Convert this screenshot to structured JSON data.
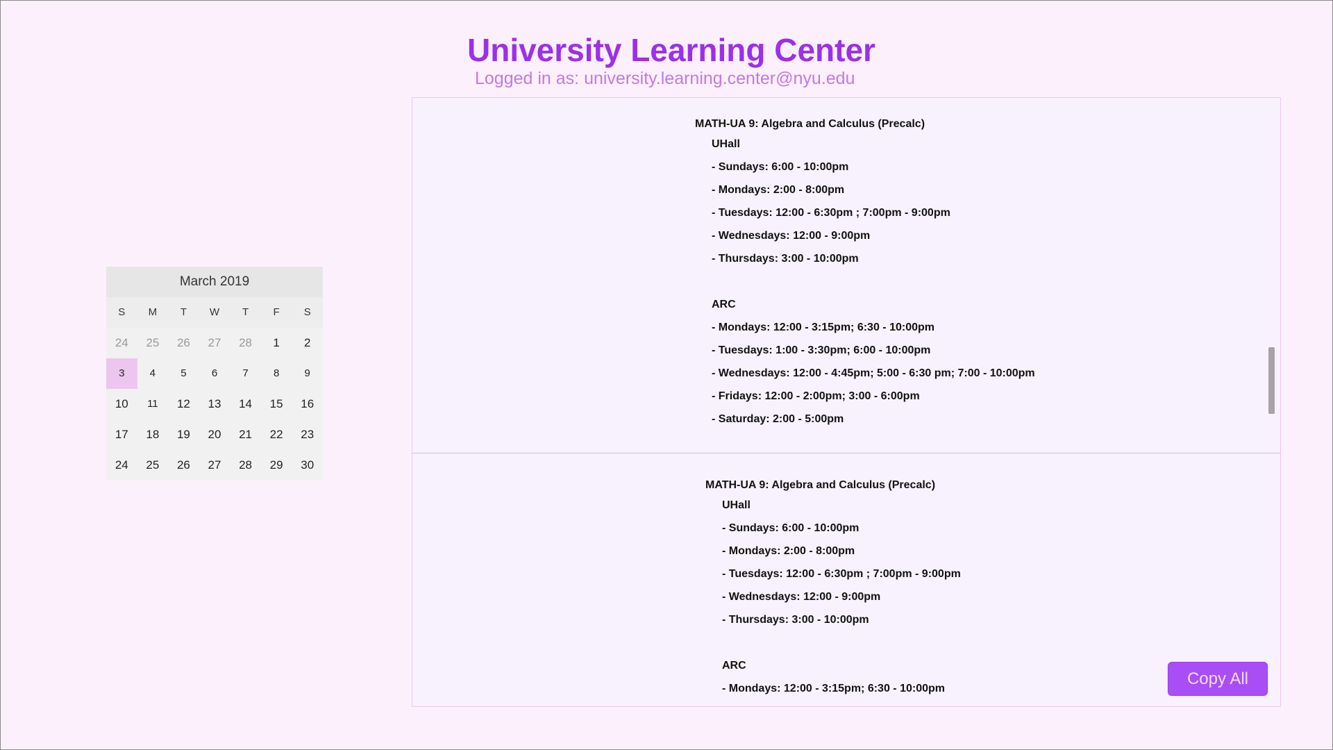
{
  "header": {
    "title": "University Learning Center",
    "login_text": "Logged in as: university.learning.center@nyu.edu"
  },
  "calendar": {
    "month_label": "March 2019",
    "weekdays": [
      "S",
      "M",
      "T",
      "W",
      "T",
      "F",
      "S"
    ],
    "weeks": [
      [
        "24",
        "25",
        "26",
        "27",
        "28",
        "1",
        "2"
      ],
      [
        "3",
        "4",
        "5",
        "6",
        "7",
        "8",
        "9"
      ],
      [
        "10",
        "11",
        "12",
        "13",
        "14",
        "15",
        "16"
      ],
      [
        "17",
        "18",
        "19",
        "20",
        "21",
        "22",
        "23"
      ],
      [
        "24",
        "25",
        "26",
        "27",
        "28",
        "29",
        "30"
      ]
    ],
    "selected_day": "3"
  },
  "entries": [
    {
      "course": "MATH-UA 9: Algebra and Calculus (Precalc)",
      "lines": [
        "UHall",
        "- Sundays: 6:00 - 10:00pm",
        "- Mondays: 2:00 - 8:00pm",
        "- Tuesdays: 12:00 - 6:30pm ; 7:00pm - 9:00pm",
        "- Wednesdays: 12:00 - 9:00pm",
        "- Thursdays: 3:00 - 10:00pm",
        "",
        "ARC",
        "- Mondays: 12:00 - 3:15pm; 6:30 - 10:00pm",
        "- Tuesdays: 1:00 - 3:30pm; 6:00 - 10:00pm",
        "- Wednesdays: 12:00 - 4:45pm; 5:00 - 6:30 pm; 7:00 - 10:00pm",
        "- Fridays: 12:00 - 2:00pm; 3:00 - 6:00pm",
        "- Saturday: 2:00 - 5:00pm"
      ]
    },
    {
      "course": "MATH-UA 9: Algebra and Calculus (Precalc)",
      "lines": [
        "UHall",
        "- Sundays: 6:00 - 10:00pm",
        "- Mondays: 2:00 - 8:00pm",
        "- Tuesdays: 12:00 - 6:30pm ; 7:00pm - 9:00pm",
        "- Wednesdays: 12:00 - 9:00pm",
        "- Thursdays: 3:00 - 10:00pm",
        "",
        "ARC",
        "- Mondays: 12:00 - 3:15pm; 6:30 - 10:00pm"
      ]
    }
  ],
  "actions": {
    "copy_all_label": "Copy All"
  },
  "colors": {
    "background": "#fdf0fd",
    "title": "#9b30e8",
    "login": "#c07ae0",
    "button": "#a94ef5",
    "selected_day": "#ecc6ee"
  }
}
